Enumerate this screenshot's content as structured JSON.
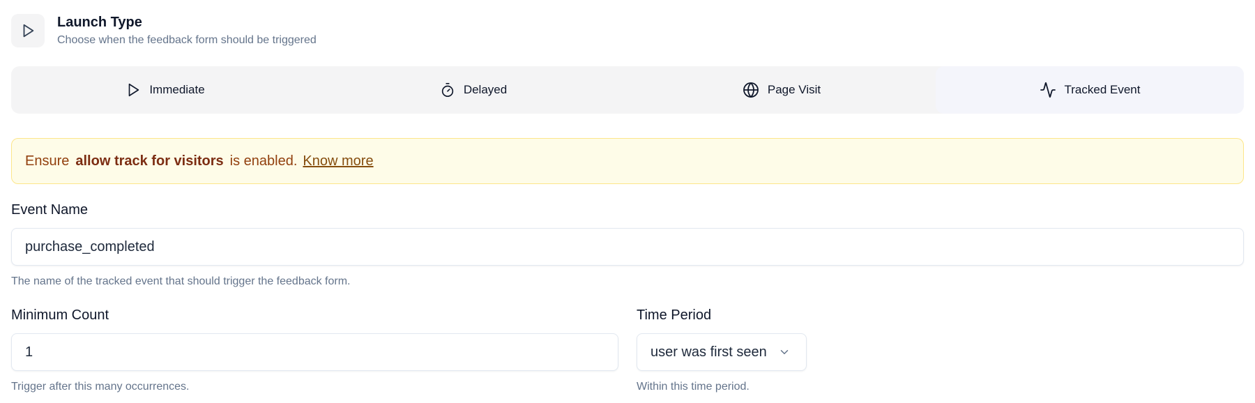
{
  "header": {
    "icon": "play-icon",
    "title": "Launch Type",
    "subtitle": "Choose when the feedback form should be triggered"
  },
  "tabs": [
    {
      "label": "Immediate",
      "icon": "play-icon",
      "active": false
    },
    {
      "label": "Delayed",
      "icon": "timer-icon",
      "active": false
    },
    {
      "label": "Page Visit",
      "icon": "globe-icon",
      "active": false
    },
    {
      "label": "Tracked Event",
      "icon": "activity-icon",
      "active": true
    }
  ],
  "alert": {
    "prefix": "Ensure",
    "emphasis": "allow track for visitors",
    "suffix": "is enabled.",
    "link": "Know more"
  },
  "event_name": {
    "label": "Event Name",
    "value": "purchase_completed",
    "help": "The name of the tracked event that should trigger the feedback form."
  },
  "minimum_count": {
    "label": "Minimum Count",
    "value": "1",
    "help": "Trigger after this many occurrences."
  },
  "time_period": {
    "label": "Time Period",
    "selected": "user was first seen",
    "help": "Within this time period."
  },
  "colors": {
    "alert_bg": "#fefce8",
    "alert_border": "#fde68a",
    "alert_text": "#92400e",
    "tab_bg": "#f4f4f5",
    "tab_active_bg": "#f4f5fb"
  }
}
